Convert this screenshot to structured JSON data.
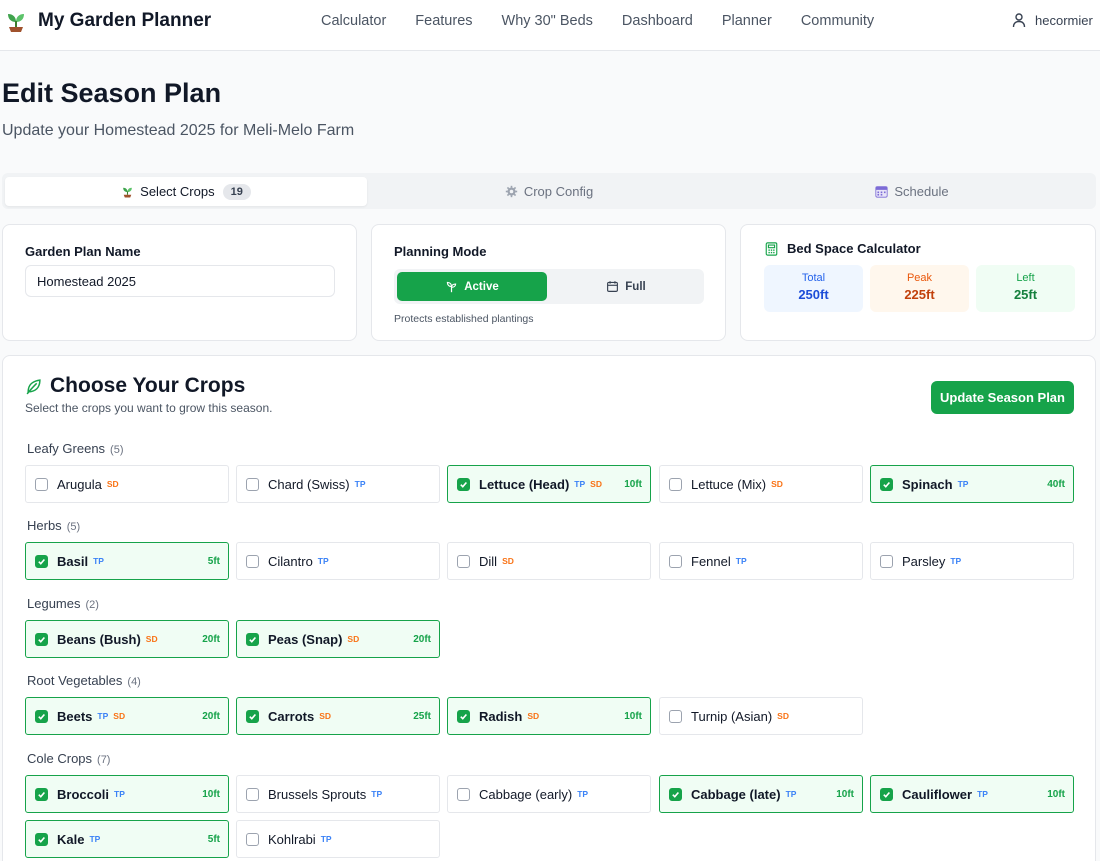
{
  "header": {
    "app_title": "My Garden Planner",
    "nav": [
      "Calculator",
      "Features",
      "Why 30\" Beds",
      "Dashboard",
      "Planner",
      "Community"
    ],
    "username": "hecormier"
  },
  "page": {
    "title": "Edit Season Plan",
    "subtitle": "Update your Homestead 2025 for Meli-Melo Farm"
  },
  "tabs": [
    {
      "label": "Select Crops",
      "badge": "19",
      "icon": "seedling-icon"
    },
    {
      "label": "Crop Config",
      "icon": "gear-icon"
    },
    {
      "label": "Schedule",
      "icon": "calendar-icon"
    }
  ],
  "plan_name": {
    "label": "Garden Plan Name",
    "value": "Homestead 2025"
  },
  "planning_mode": {
    "label": "Planning Mode",
    "active_label": "Active",
    "full_label": "Full",
    "note": "Protects established plantings"
  },
  "bed_space": {
    "title": "Bed Space Calculator",
    "total_label": "Total",
    "total_value": "250ft",
    "peak_label": "Peak",
    "peak_value": "225ft",
    "left_label": "Left",
    "left_value": "25ft"
  },
  "crops": {
    "title": "Choose Your Crops",
    "subtitle": "Select the crops you want to grow this season.",
    "update_button": "Update Season Plan",
    "categories": [
      {
        "name": "Leafy Greens",
        "count": "(5)",
        "items": [
          {
            "name": "Arugula",
            "tags": [
              "SD"
            ],
            "selected": false,
            "space": ""
          },
          {
            "name": "Chard (Swiss)",
            "tags": [
              "TP"
            ],
            "selected": false,
            "space": ""
          },
          {
            "name": "Lettuce (Head)",
            "tags": [
              "TP",
              "SD"
            ],
            "selected": true,
            "space": "10ft"
          },
          {
            "name": "Lettuce (Mix)",
            "tags": [
              "SD"
            ],
            "selected": false,
            "space": ""
          },
          {
            "name": "Spinach",
            "tags": [
              "TP"
            ],
            "selected": true,
            "space": "40ft"
          }
        ]
      },
      {
        "name": "Herbs",
        "count": "(5)",
        "items": [
          {
            "name": "Basil",
            "tags": [
              "TP"
            ],
            "selected": true,
            "space": "5ft"
          },
          {
            "name": "Cilantro",
            "tags": [
              "TP"
            ],
            "selected": false,
            "space": ""
          },
          {
            "name": "Dill",
            "tags": [
              "SD"
            ],
            "selected": false,
            "space": ""
          },
          {
            "name": "Fennel",
            "tags": [
              "TP"
            ],
            "selected": false,
            "space": ""
          },
          {
            "name": "Parsley",
            "tags": [
              "TP"
            ],
            "selected": false,
            "space": ""
          }
        ]
      },
      {
        "name": "Legumes",
        "count": "(2)",
        "items": [
          {
            "name": "Beans (Bush)",
            "tags": [
              "SD"
            ],
            "selected": true,
            "space": "20ft"
          },
          {
            "name": "Peas (Snap)",
            "tags": [
              "SD"
            ],
            "selected": true,
            "space": "20ft"
          }
        ]
      },
      {
        "name": "Root Vegetables",
        "count": "(4)",
        "items": [
          {
            "name": "Beets",
            "tags": [
              "TP",
              "SD"
            ],
            "selected": true,
            "space": "20ft"
          },
          {
            "name": "Carrots",
            "tags": [
              "SD"
            ],
            "selected": true,
            "space": "25ft"
          },
          {
            "name": "Radish",
            "tags": [
              "SD"
            ],
            "selected": true,
            "space": "10ft"
          },
          {
            "name": "Turnip (Asian)",
            "tags": [
              "SD"
            ],
            "selected": false,
            "space": ""
          }
        ]
      },
      {
        "name": "Cole Crops",
        "count": "(7)",
        "items": [
          {
            "name": "Broccoli",
            "tags": [
              "TP"
            ],
            "selected": true,
            "space": "10ft"
          },
          {
            "name": "Brussels Sprouts",
            "tags": [
              "TP"
            ],
            "selected": false,
            "space": ""
          },
          {
            "name": "Cabbage (early)",
            "tags": [
              "TP"
            ],
            "selected": false,
            "space": ""
          },
          {
            "name": "Cabbage (late)",
            "tags": [
              "TP"
            ],
            "selected": true,
            "space": "10ft"
          },
          {
            "name": "Cauliflower",
            "tags": [
              "TP"
            ],
            "selected": true,
            "space": "10ft"
          },
          {
            "name": "Kale",
            "tags": [
              "TP"
            ],
            "selected": true,
            "space": "5ft"
          },
          {
            "name": "Kohlrabi",
            "tags": [
              "TP"
            ],
            "selected": false,
            "space": ""
          }
        ]
      }
    ]
  },
  "colors": {
    "accent": "#16a34a",
    "tp_tag": "#3b82f6",
    "sd_tag": "#f97316"
  }
}
